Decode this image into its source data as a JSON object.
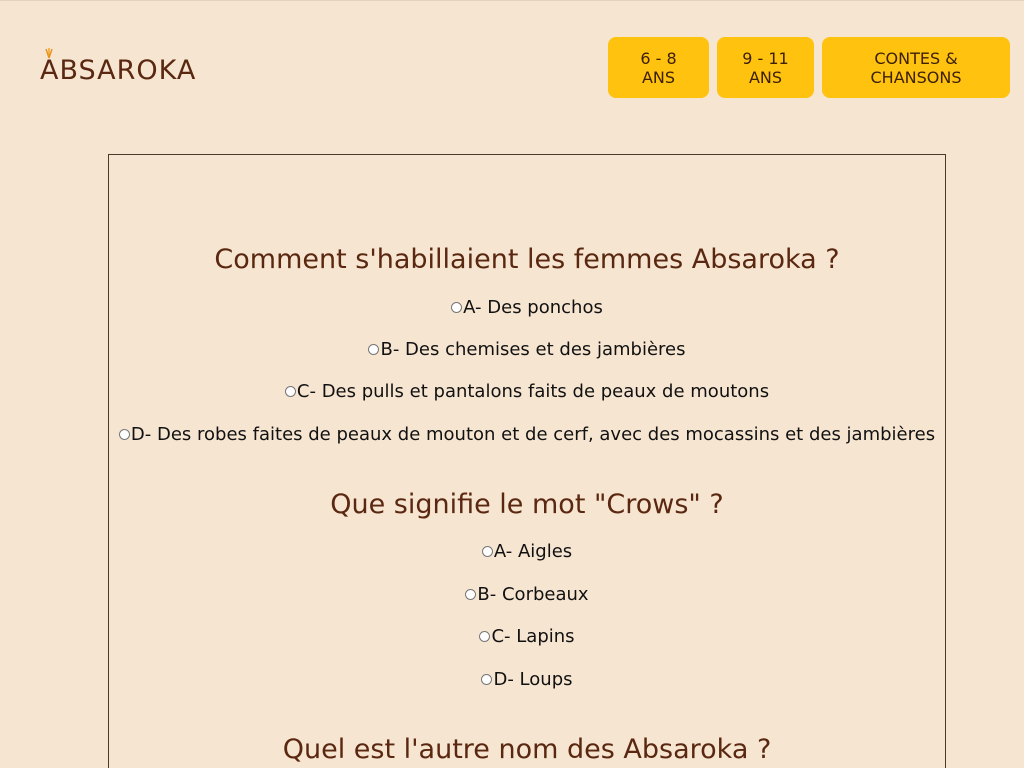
{
  "header": {
    "logo_text": "BSAROKA",
    "logo_first": "A",
    "nav": [
      {
        "label": "6 - 8 ans"
      },
      {
        "label": "9 - 11 ans"
      },
      {
        "label": "Contes & Chansons"
      }
    ]
  },
  "quiz": {
    "questions": [
      {
        "title": "Comment s'habillaient les femmes Absaroka ?",
        "options": [
          "A- Des ponchos",
          "B- Des chemises et des jambières",
          "C- Des pulls et pantalons faits de peaux de moutons",
          "D- Des robes faites de peaux de mouton et de cerf, avec des mocassins et des jambières"
        ]
      },
      {
        "title": "Que signifie le mot \"Crows\" ?",
        "options": [
          "A- Aigles",
          "B- Corbeaux",
          "C- Lapins",
          "D- Loups"
        ]
      },
      {
        "title": "Quel est l'autre nom des Absaroka ?",
        "options": []
      }
    ]
  },
  "colors": {
    "background": "#f6e5d1",
    "accent": "#ffc20e",
    "title_brown": "#5a2710"
  }
}
